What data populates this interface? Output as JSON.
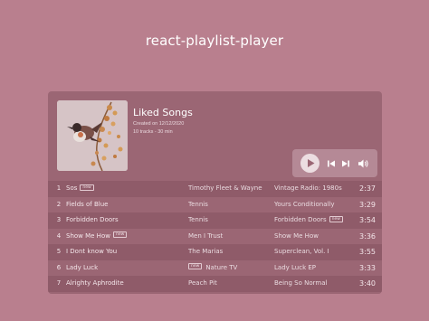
{
  "app": {
    "title": "react-playlist-player"
  },
  "playlist": {
    "title": "Liked Songs",
    "created": "Created on 12/12/2020",
    "summary": "10 tracks - 30 min",
    "cover_icon": "bird-on-branch-artwork"
  },
  "controls": {
    "play_icon": "play-icon",
    "prev_icon": "skip-previous-icon",
    "next_icon": "skip-next-icon",
    "volume_icon": "volume-icon"
  },
  "tracks": [
    {
      "num": "1",
      "title": "Sos",
      "tag": "new",
      "artist": "Timothy Fleet  &  Wayne",
      "album": "Vintage Radio: 1980s",
      "album_tag": "",
      "artist_tag": "",
      "time": "2:37"
    },
    {
      "num": "2",
      "title": "Fields of Blue",
      "tag": "",
      "artist": "Tennis",
      "album": "Yours Conditionally",
      "album_tag": "",
      "artist_tag": "",
      "time": "3:29"
    },
    {
      "num": "3",
      "title": "Forbidden Doors",
      "tag": "",
      "artist": "Tennis",
      "album": "Forbidden Doors",
      "album_tag": "new",
      "artist_tag": "",
      "time": "3:54"
    },
    {
      "num": "4",
      "title": "Show Me How",
      "tag": "new",
      "artist": "Men I Trust",
      "album": "Show Me How",
      "album_tag": "",
      "artist_tag": "",
      "time": "3:36"
    },
    {
      "num": "5",
      "title": "I Dont know You",
      "tag": "",
      "artist": "The Marias",
      "album": "Superclean, Vol. I",
      "album_tag": "",
      "artist_tag": "",
      "time": "3:55"
    },
    {
      "num": "6",
      "title": "Lady Luck",
      "tag": "",
      "artist": "Nature TV",
      "album": "Lady Luck EP",
      "album_tag": "",
      "artist_tag": "new",
      "time": "3:33"
    },
    {
      "num": "7",
      "title": "Alrighty Aphrodite",
      "tag": "",
      "artist": "Peach Pit",
      "album": "Being So Normal",
      "album_tag": "",
      "artist_tag": "",
      "time": "3:40"
    }
  ],
  "colors": {
    "background": "#b97f8e",
    "panel": "#9b6674",
    "controls_bg": "#b58996"
  }
}
